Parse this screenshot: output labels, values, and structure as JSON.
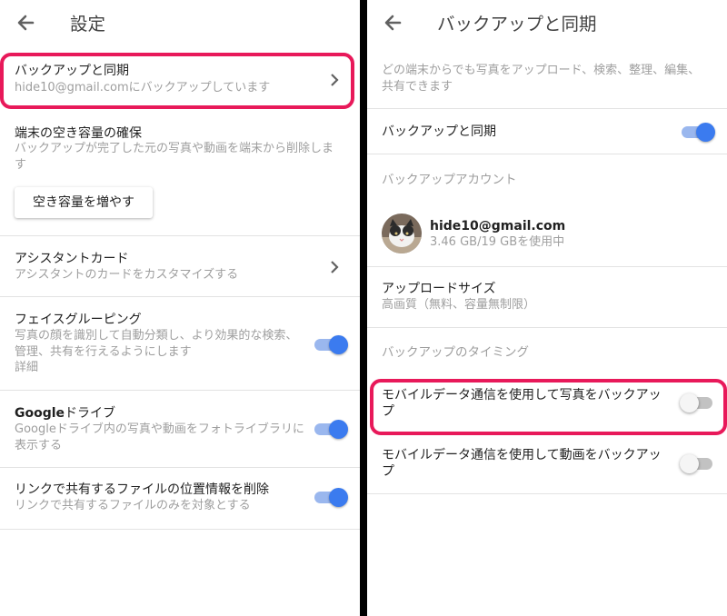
{
  "left": {
    "title": "設定",
    "backup": {
      "title": "バックアップと同期",
      "subtitle": "hide10@gmail.comにバックアップしています"
    },
    "free_space": {
      "title": "端末の空き容量の確保",
      "subtitle": "バックアップが完了した元の写真や動画を端末から削除します",
      "button": "空き容量を増やす"
    },
    "assistant": {
      "title": "アシスタントカード",
      "subtitle": "アシスタントのカードをカスタマイズする"
    },
    "face": {
      "title": "フェイスグルーピング",
      "subtitle": "写真の顔を識別して自動分類し、より効果的な検索、管理、共有を行えるようにします",
      "details": "詳細",
      "enabled": true
    },
    "drive": {
      "title_bold": "Google",
      "title_rest": "ドライブ",
      "subtitle": "Googleドライブ内の写真や動画をフォトライブラリに表示する",
      "enabled": true
    },
    "location": {
      "title": "リンクで共有するファイルの位置情報を削除",
      "subtitle": "リンクで共有するファイルのみを対象とする",
      "enabled": true
    }
  },
  "right": {
    "title": "バックアップと同期",
    "intro": "どの端末からでも写真をアップロード、検索、整理、編集、共有できます",
    "sync": {
      "label": "バックアップと同期",
      "enabled": true
    },
    "account_header": "バックアップアカウント",
    "account": {
      "email": "hide10@gmail.com",
      "usage": "3.46 GB/19 GBを使用中"
    },
    "upload_size": {
      "title": "アップロードサイズ",
      "subtitle": "高画質（無料、容量無制限）"
    },
    "timing_header": "バックアップのタイミング",
    "mobile_photos": {
      "label": "モバイルデータ通信を使用して写真をバックアップ",
      "enabled": false
    },
    "mobile_videos": {
      "label": "モバイルデータ通信を使用して動画をバックアップ",
      "enabled": false
    }
  },
  "colors": {
    "accent": "#3b7bef",
    "highlight": "#e8195a",
    "divider": "#e3e3e3",
    "secondary_text": "#9e9e9e"
  }
}
